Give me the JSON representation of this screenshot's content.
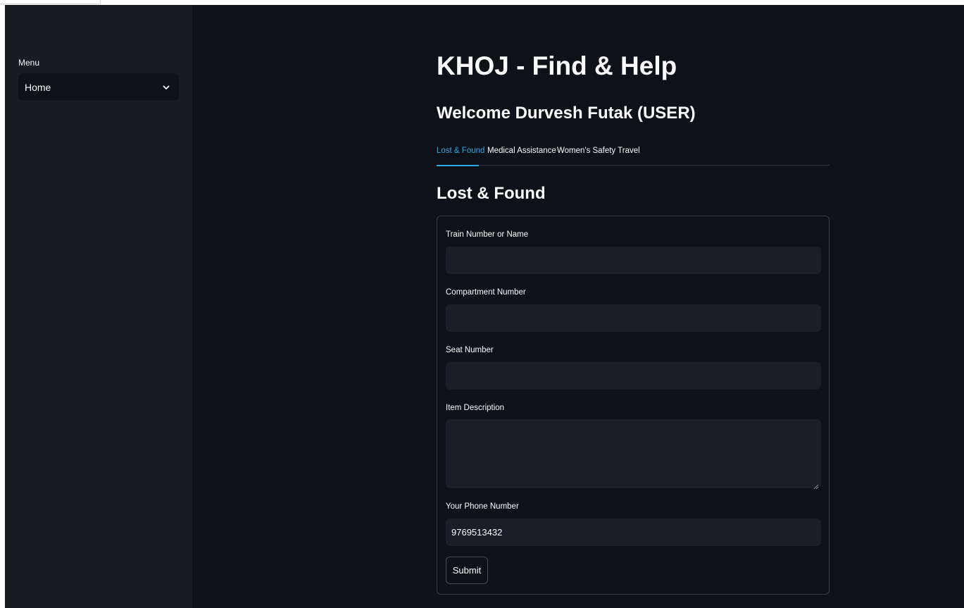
{
  "sidebar": {
    "menu_label": "Menu",
    "menu_select_value": "Home"
  },
  "header": {
    "title": "KHOJ - Find & Help",
    "welcome": "Welcome Durvesh Futak (USER)"
  },
  "tabs": [
    {
      "label": "Lost & Found",
      "active": true
    },
    {
      "label": "Medical Assistance",
      "active": false
    },
    {
      "label": "Women's Safety Travel",
      "active": false
    }
  ],
  "section": {
    "title": "Lost & Found"
  },
  "form": {
    "train": {
      "label": "Train Number or Name",
      "value": ""
    },
    "compartment": {
      "label": "Compartment Number",
      "value": ""
    },
    "seat": {
      "label": "Seat Number",
      "value": ""
    },
    "item_description": {
      "label": "Item Description",
      "value": ""
    },
    "phone": {
      "label": "Your Phone Number",
      "value": "9769513432"
    },
    "submit_label": "Submit"
  },
  "colors": {
    "background": "#0e1117",
    "sidebar": "#1a1c24",
    "input": "#1a1e29",
    "accent": "#2ea8e5",
    "text": "#fafafa"
  }
}
